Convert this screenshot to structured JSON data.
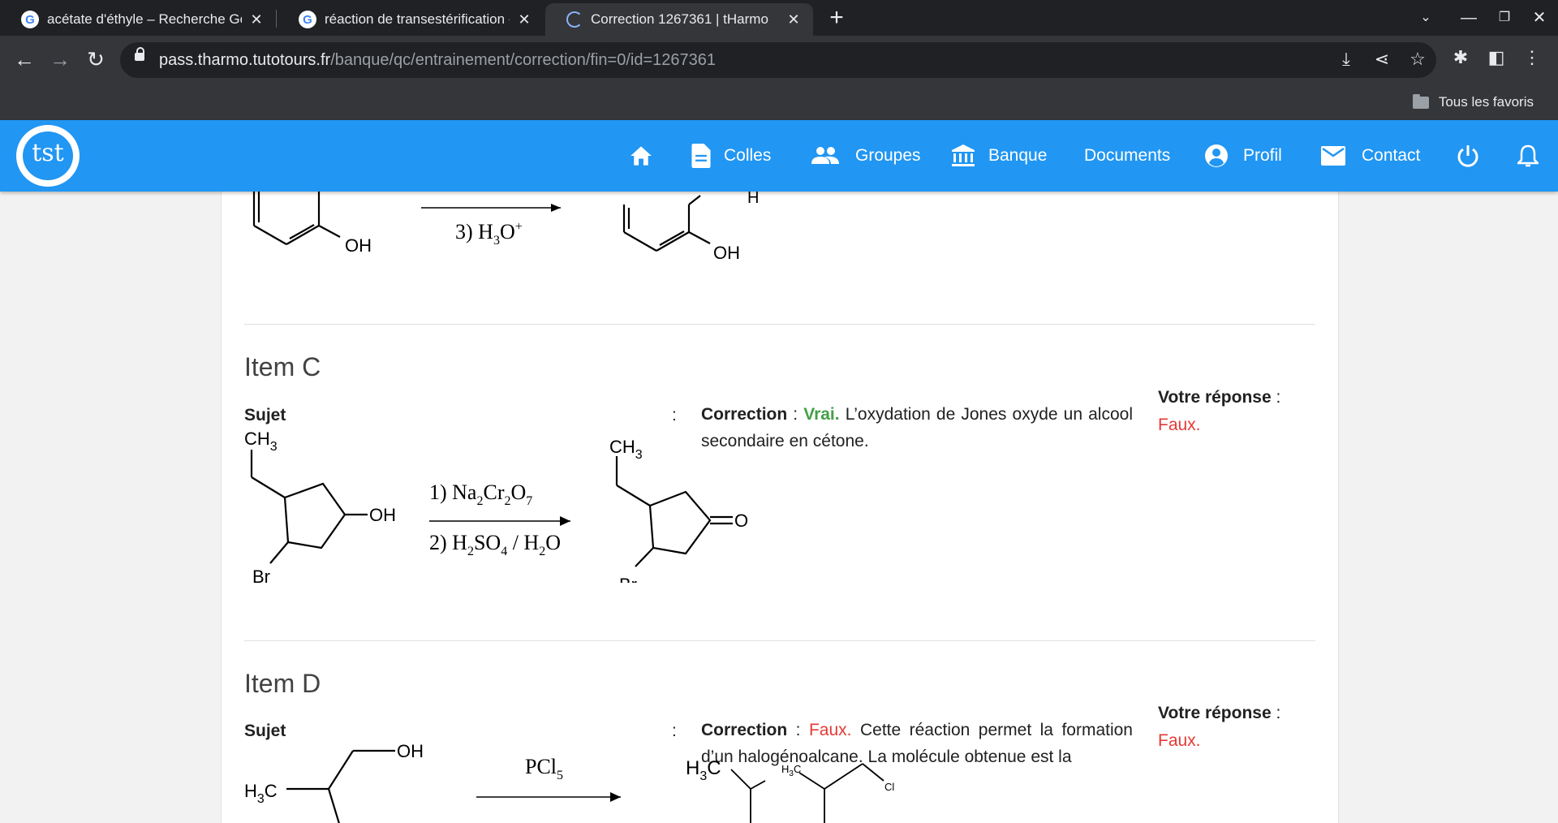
{
  "browser": {
    "tabs": [
      {
        "title": "acétate d'éthyle – Recherche Go",
        "close": "✕"
      },
      {
        "title": "réaction de transestérification -",
        "close": "✕"
      },
      {
        "title": "Correction 1267361 | tHarmo",
        "close": "✕"
      }
    ],
    "new_tab": "+",
    "url_host": "pass.tharmo.tutotours.fr",
    "url_path": "/banque/qc/entrainement/correction/fin=0/id=1267361",
    "bookmarks_all": "Tous les favoris"
  },
  "site_nav": {
    "logo": "tst",
    "items": [
      {
        "label": "",
        "icon": "home-icon"
      },
      {
        "label": "Colles",
        "icon": "document-icon"
      },
      {
        "label": "Groupes",
        "icon": "people-icon"
      },
      {
        "label": "Banque",
        "icon": "bank-icon"
      },
      {
        "label": "Documents",
        "icon": ""
      },
      {
        "label": "Profil",
        "icon": "account-icon"
      },
      {
        "label": "Contact",
        "icon": "mail-icon"
      },
      {
        "label": "",
        "icon": "power-icon"
      },
      {
        "label": "",
        "icon": "bell-icon"
      }
    ]
  },
  "content": {
    "top_reaction": {
      "step": "3) H",
      "sub3": "3",
      "o": "O",
      "plus": "+",
      "oh_left": "OH",
      "oh_right": "OH",
      "h": "H"
    },
    "items": [
      {
        "title": "Item C",
        "sujet_label": "Sujet",
        "colon": ":",
        "correction_label": "Correction",
        "verdict": "Vrai.",
        "correction_text": "L’oxydation de Jones oxyde un alcool secondaire en cétone.",
        "votre_reponse_label": "Votre réponse",
        "votre_reponse": "Faux.",
        "scheme": {
          "reactant_ch3": "CH",
          "sub3": "3",
          "oh": "OH",
          "br": "Br",
          "step1_prefix": "1) Na",
          "step1_cr": "Cr",
          "step1_o": "O",
          "sub2": "2",
          "sub7": "7",
          "step2_prefix": "2) H",
          "step2_so": "SO",
          "sub4": "4",
          "step2_h": " / H",
          "step2_o": "O",
          "product_ch3": "CH",
          "product_o": "O",
          "product_br": "Br"
        }
      },
      {
        "title": "Item D",
        "sujet_label": "Sujet",
        "colon": ":",
        "correction_label": "Correction",
        "verdict": "Faux.",
        "correction_text": "Cette réaction permet la formation d’un halogénoalcane. La molécule obtenue est la",
        "votre_reponse_label": "Votre réponse",
        "votre_reponse": "Faux.",
        "scheme": {
          "oh": "OH",
          "h3c": "H",
          "sub3": "3",
          "c": "C",
          "reagent": "PCl",
          "sub5": "5",
          "product_h3c": "H",
          "small_h3c": "H",
          "small_c": "C",
          "cl": "Cl"
        }
      }
    ]
  }
}
